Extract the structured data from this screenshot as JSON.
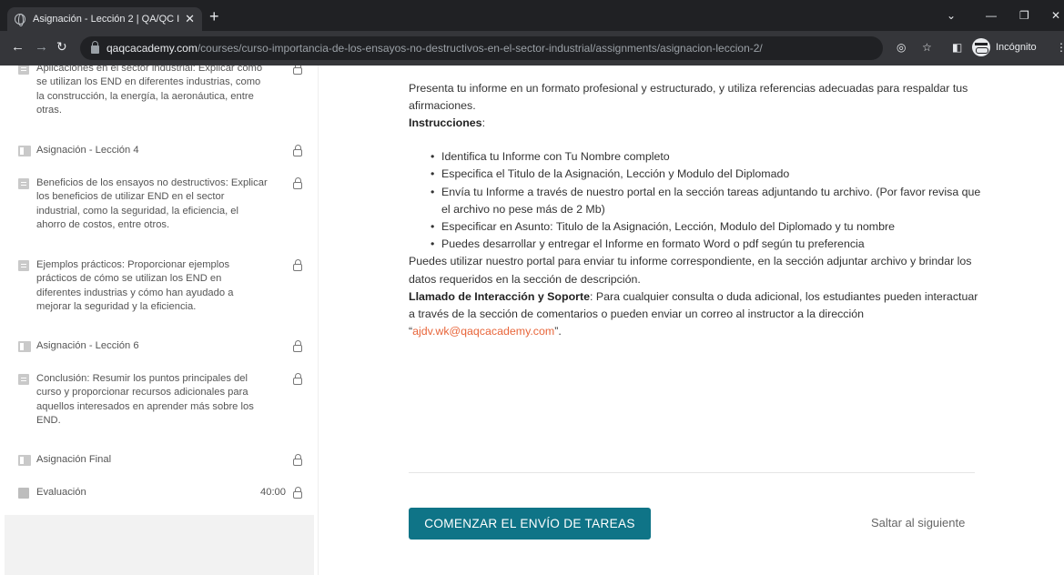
{
  "browser": {
    "tab_title": "Asignación - Lección 2 | QA/QC I",
    "url_host": "qaqcacademy.com",
    "url_path": "/courses/curso-importancia-de-los-ensayos-no-destructivos-en-el-sector-industrial/assignments/asignacion-leccion-2/",
    "incognito_label": "Incógnito"
  },
  "sidebar": {
    "items": [
      {
        "type": "doc",
        "text": "Aplicaciones en el sector industrial: Explicar cómo se utilizan los END en diferentes industrias, como la construcción, la energía, la aeronáutica, entre otras."
      },
      {
        "type": "assignment",
        "text": "Asignación - Lección 4"
      },
      {
        "type": "doc",
        "text": "Beneficios de los ensayos no destructivos: Explicar los beneficios de utilizar END en el sector industrial, como la seguridad, la eficiencia, el ahorro de costos, entre otros."
      },
      {
        "type": "doc",
        "text": "Ejemplos prácticos: Proporcionar ejemplos prácticos de cómo se utilizan los END en diferentes industrias y cómo han ayudado a mejorar la seguridad y la eficiencia."
      },
      {
        "type": "assignment",
        "text": "Asignación - Lección 6"
      },
      {
        "type": "doc",
        "text": "Conclusión: Resumir los puntos principales del curso y proporcionar recursos adicionales para aquellos interesados en aprender más sobre los END."
      },
      {
        "type": "assignment",
        "text": "Asignación Final"
      },
      {
        "type": "quiz",
        "text": "Evaluación",
        "duration": "40:00"
      }
    ]
  },
  "main": {
    "intro": "Presenta tu informe en un formato profesional y estructurado, y utiliza referencias adecuadas para respaldar tus afirmaciones.",
    "instructions_label": "Instrucciones",
    "instructions": [
      "Identifica tu Informe con Tu Nombre completo",
      "Especifica el Titulo de la Asignación, Lección y Modulo del Diplomado",
      "Envía tu Informe a través de nuestro portal en la sección tareas adjuntando tu archivo. (Por favor revisa que el archivo no pese más de 2 Mb)",
      "Especificar en Asunto: Titulo de la Asignación, Lección, Modulo del Diplomado y tu nombre",
      "Puedes desarrollar y entregar el Informe en formato Word o pdf según tu preferencia"
    ],
    "portal_text": "Puedes utilizar nuestro portal para enviar tu informe correspondiente, en la sección adjuntar archivo y brindar los datos requeridos en la sección de descripción.",
    "support_label": "Llamado de Interacción y Soporte",
    "support_text": ": Para cualquier consulta o duda adicional, los estudiantes pueden interactuar a través de la sección de comentarios o pueden enviar un correo al instructor a la dirección “",
    "support_email": "ajdv.wk@qaqcacademy.com",
    "support_end": "”.",
    "submit_label": "COMENZAR EL ENVÍO DE TAREAS",
    "skip_label": "Saltar al siguiente"
  },
  "colors": {
    "button": "#0f7487",
    "email_link": "#e8653a"
  }
}
